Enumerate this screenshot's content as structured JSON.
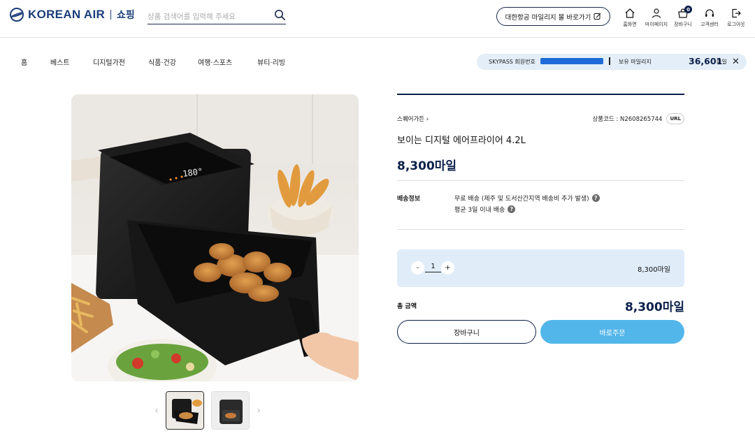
{
  "header": {
    "logo_text": "KOREAN AIR",
    "logo_shop": "쇼핑",
    "search_placeholder": "상품 검색어를 입력해 주세요",
    "mileage_button": "대한항공 마일리지 몰 바로가기",
    "icons": [
      {
        "name": "home-icon",
        "label": "홈화면"
      },
      {
        "name": "user-icon",
        "label": "마이페이지"
      },
      {
        "name": "cart-icon",
        "label": "장바구니",
        "badge": "0"
      },
      {
        "name": "headset-icon",
        "label": "고객센터"
      },
      {
        "name": "logout-icon",
        "label": "로그아웃"
      }
    ]
  },
  "nav": {
    "items": [
      "홈",
      "베스트",
      "디지털가전",
      "식품·건강",
      "여행·스포츠",
      "뷰티·리빙"
    ]
  },
  "skypass": {
    "label": "SKYPASS 회원번호",
    "hold_label": "보유 마일리지",
    "mileage": "36,601",
    "unit": "마일"
  },
  "product": {
    "brand": "스퀘어가든",
    "code": "상품코드 : N2608265744",
    "url_label": "URL",
    "title": "보이는 디지털 에어프라이어 4.2L",
    "price": "8,300마일",
    "shipping_label": "배송정보",
    "shipping_lines": [
      "무료 배송 (제주 및 도서산간지역 배송비 추가 발생)",
      "평균 3일 이내 배송"
    ],
    "display": "180°"
  },
  "order": {
    "minus": "-",
    "plus": "+",
    "quantity": "1",
    "line_price": "8,300마일",
    "total_label": "총 금액",
    "total": "8,300마일",
    "cart_button": "장바구니",
    "buy_button": "바로주문"
  },
  "colors": {
    "navy": "#0b1f4a",
    "buy_button": "#53b6ea",
    "qty_bg": "#e0edf9",
    "skypass_bg": "#e3eef8",
    "masked": "#1e6ad8"
  }
}
